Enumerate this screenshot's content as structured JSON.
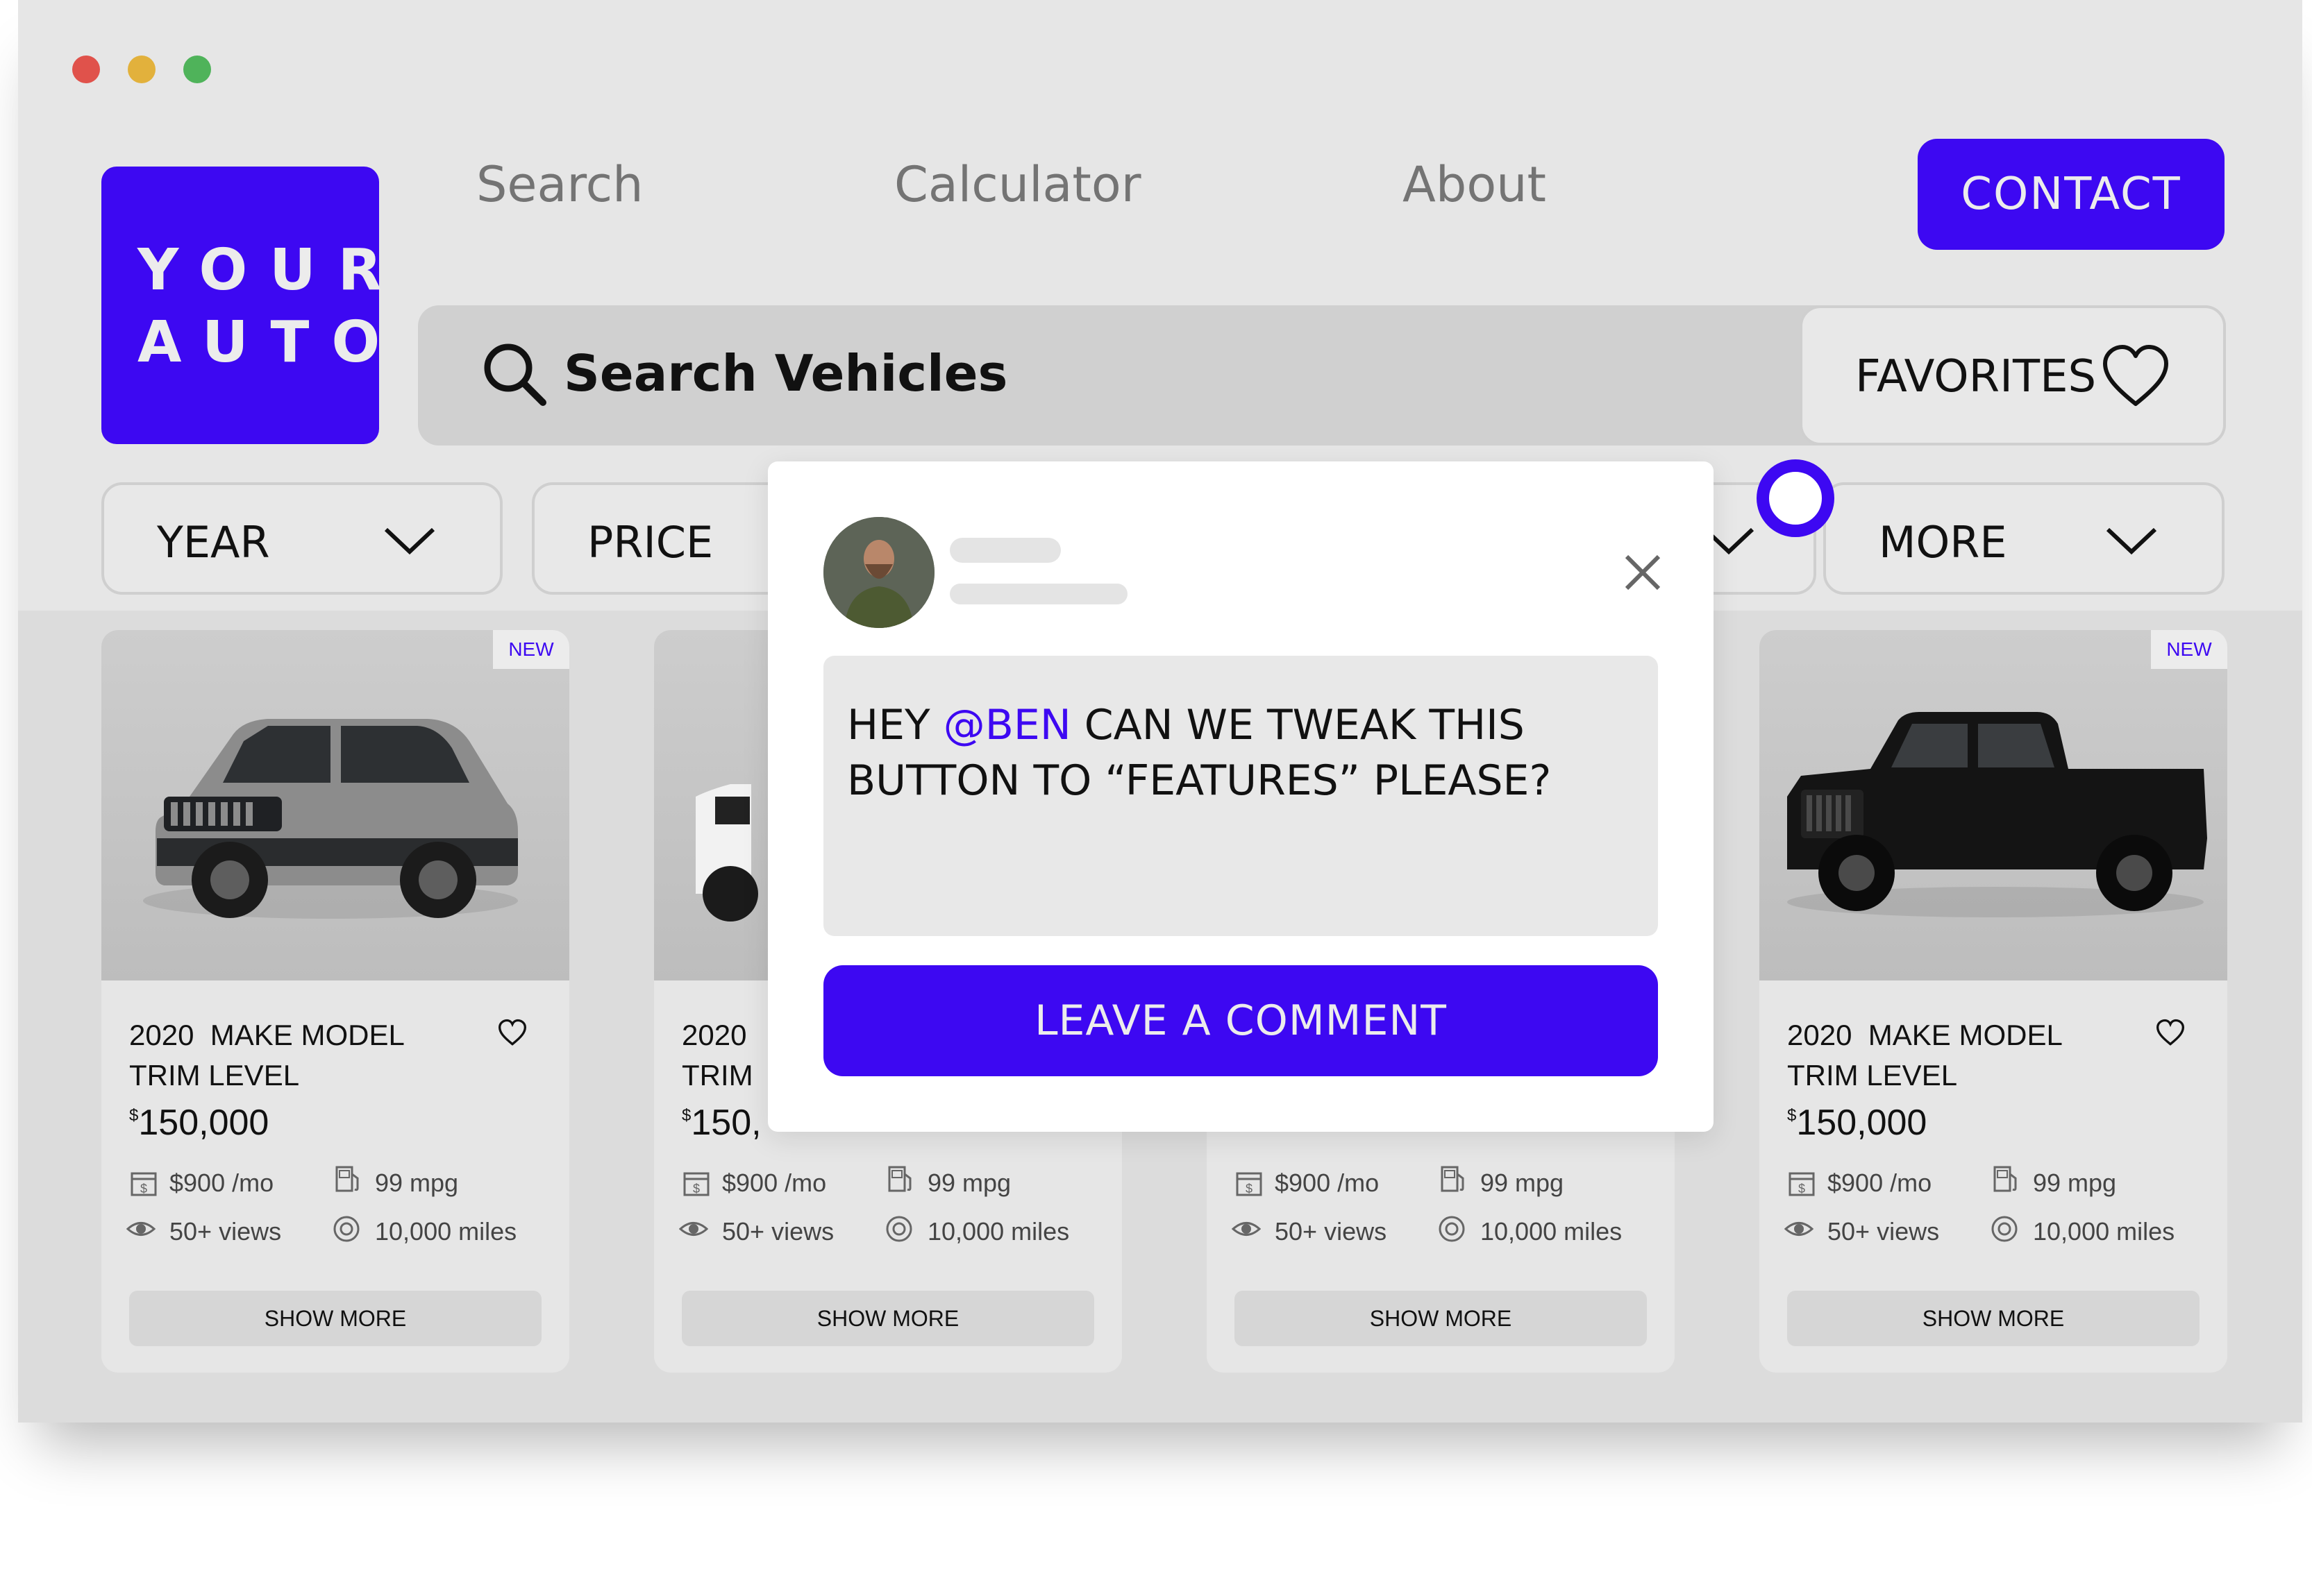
{
  "colors": {
    "accent": "#3d08f2",
    "dot_red": "#e0524b",
    "dot_yellow": "#e2b13c",
    "dot_green": "#4fb35a"
  },
  "logo": {
    "line1": "YOUR",
    "line2": "AUTO"
  },
  "nav": {
    "items": [
      "Search",
      "Calculator",
      "About"
    ],
    "contact": "CONTACT"
  },
  "search": {
    "placeholder": "Search Vehicles",
    "favorites": "FAVORITES"
  },
  "filters": [
    "YEAR",
    "PRICE",
    "MORE"
  ],
  "cards": [
    {
      "badge": "NEW",
      "title_line1": "2020  MAKE MODEL",
      "title_line2": "TRIM LEVEL",
      "currency": "$",
      "price": "150,000",
      "payment": "$900 /mo",
      "mpg": "99 mpg",
      "views": "50+ views",
      "miles": "10,000 miles",
      "button": "SHOW MORE"
    },
    {
      "badge": "",
      "title_line1": "2020",
      "title_line2": "TRIM",
      "currency": "$",
      "price": "150,",
      "payment": "$900 /mo",
      "mpg": "99 mpg",
      "views": "50+ views",
      "miles": "10,000 miles",
      "button": "SHOW MORE"
    },
    {
      "badge": "",
      "title_line1": "",
      "title_line2": "",
      "currency": "",
      "price": "",
      "payment": "$900 /mo",
      "mpg": "99 mpg",
      "views": "50+ views",
      "miles": "10,000 miles",
      "button": "SHOW MORE"
    },
    {
      "badge": "NEW",
      "title_line1": "2020  MAKE MODEL",
      "title_line2": "TRIM LEVEL",
      "currency": "$",
      "price": "150,000",
      "payment": "$900 /mo",
      "mpg": "99 mpg",
      "views": "50+ views",
      "miles": "10,000 miles",
      "button": "SHOW MORE"
    }
  ],
  "comment": {
    "text_before": "HEY ",
    "mention": "@BEN",
    "text_after": " CAN WE TWEAK THIS BUTTON TO “FEATURES” PLEASE?",
    "button": "LEAVE A COMMENT"
  }
}
